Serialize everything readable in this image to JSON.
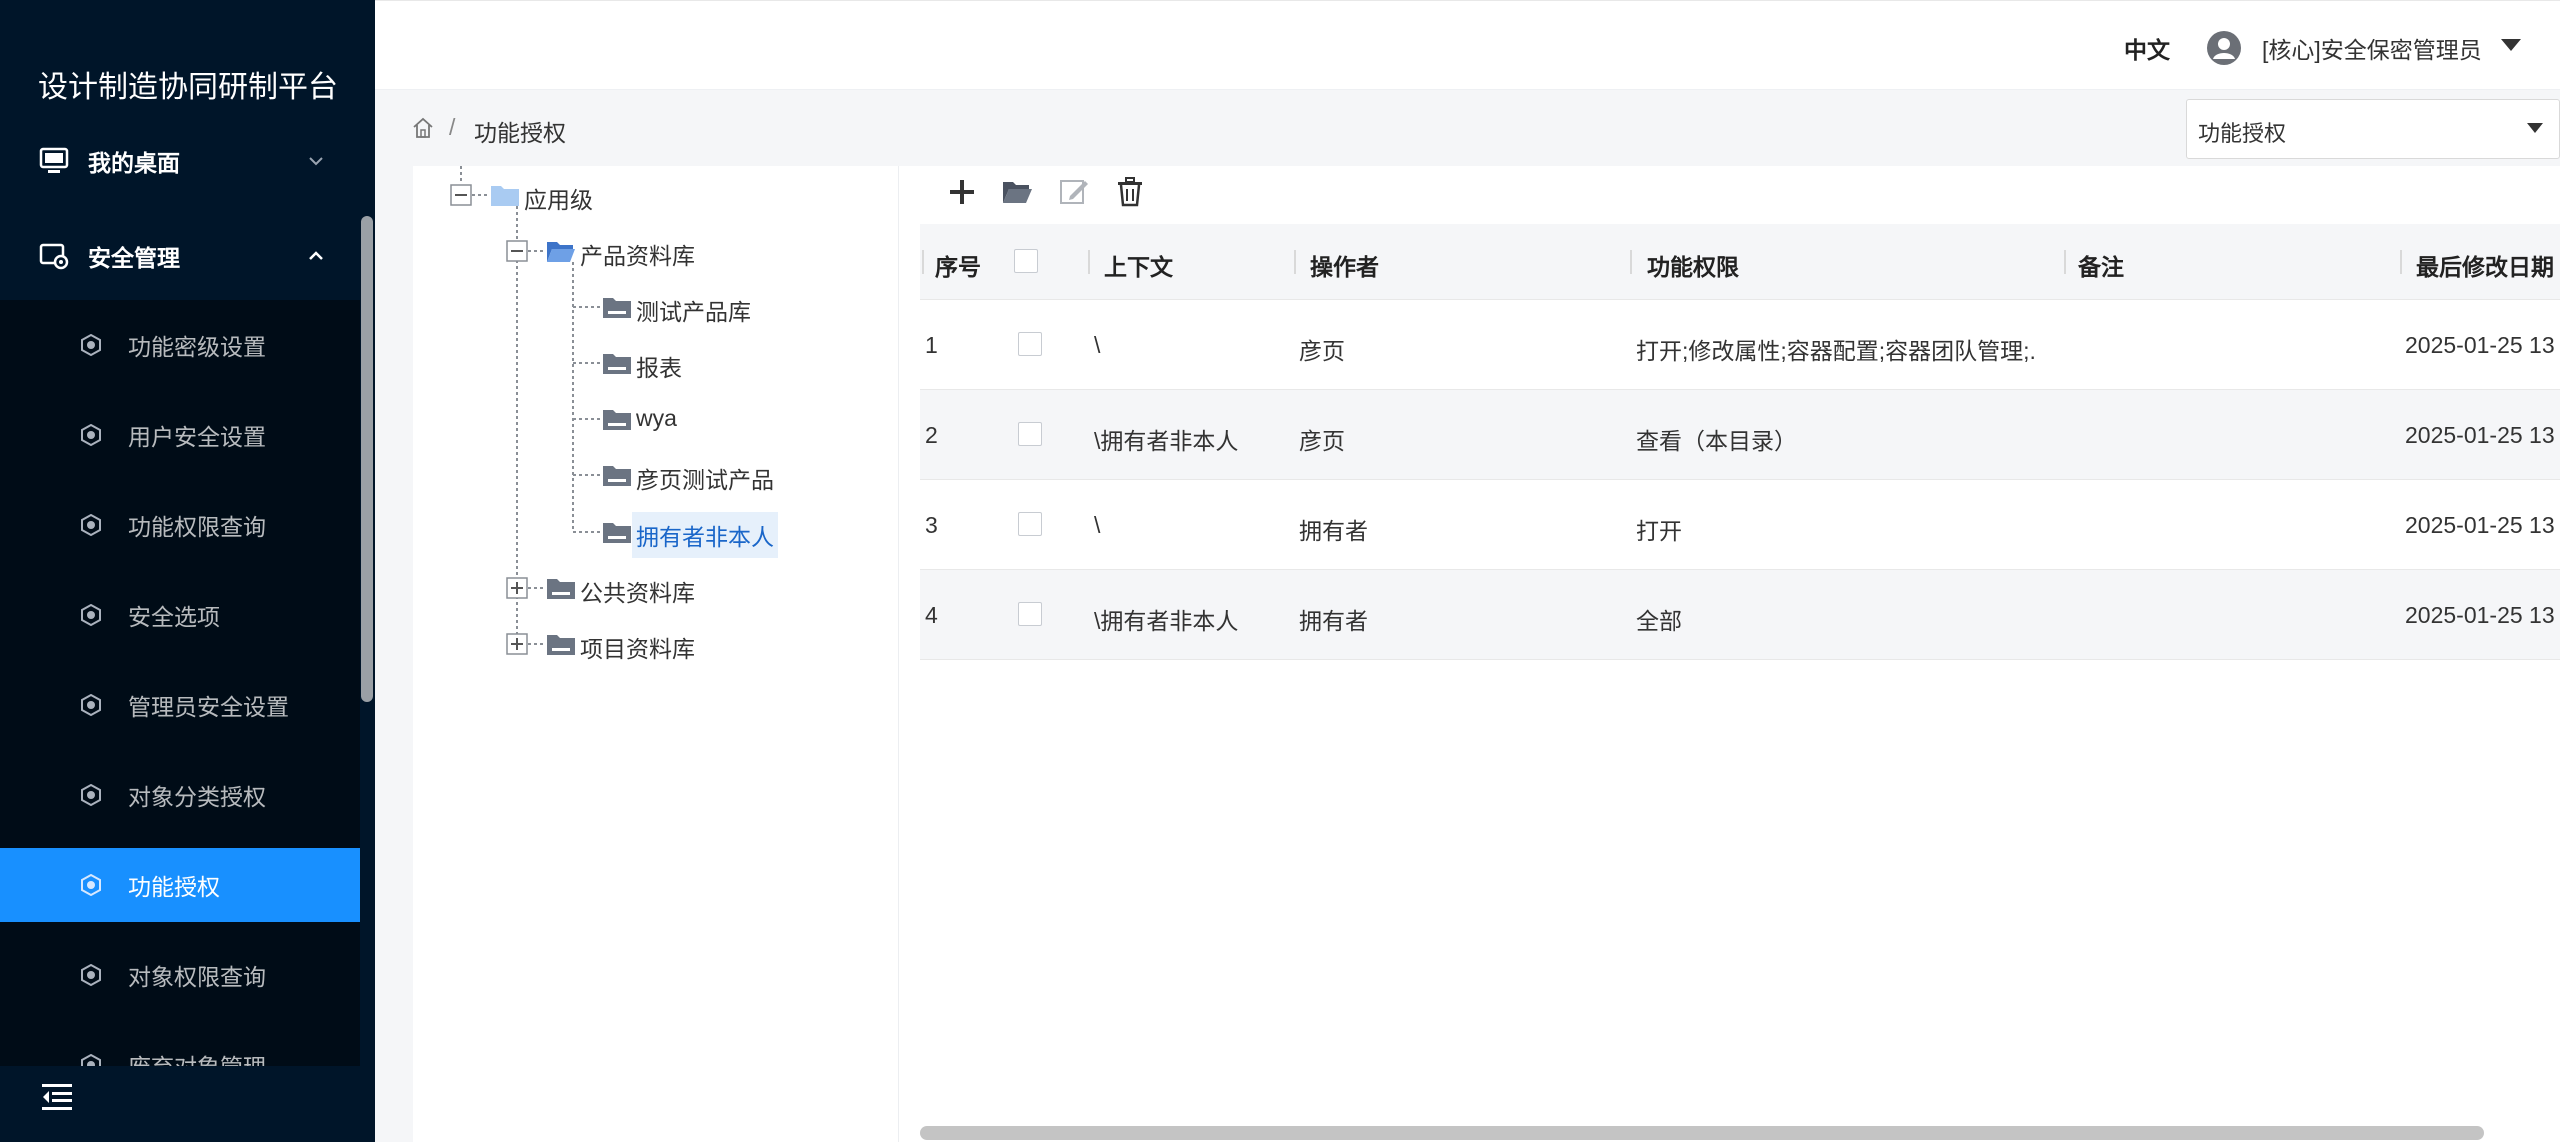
{
  "app": {
    "title": "设计制造协同研制平台"
  },
  "sidebar": {
    "groups": [
      {
        "label": "我的桌面",
        "icon": "monitor-icon",
        "expanded": false
      },
      {
        "label": "安全管理",
        "icon": "security-settings-icon",
        "expanded": true
      }
    ],
    "items": [
      {
        "label": "功能密级设置",
        "active": false
      },
      {
        "label": "用户安全设置",
        "active": false
      },
      {
        "label": "功能权限查询",
        "active": false
      },
      {
        "label": "安全选项",
        "active": false
      },
      {
        "label": "管理员安全设置",
        "active": false
      },
      {
        "label": "对象分类授权",
        "active": false
      },
      {
        "label": "功能授权",
        "active": true
      },
      {
        "label": "对象权限查询",
        "active": false
      },
      {
        "label": "废弃对象管理",
        "active": false
      }
    ]
  },
  "header": {
    "language": "中文",
    "user": "[核心]安全保密管理员"
  },
  "breadcrumb": {
    "separator": "/",
    "current": "功能授权"
  },
  "view_select": {
    "value": "功能授权"
  },
  "tree": {
    "root": "应用级",
    "product_lib": "产品资料库",
    "product_children": [
      "测试产品库",
      "报表",
      "wya",
      "彦页测试产品",
      "拥有者非本人"
    ],
    "public_lib": "公共资料库",
    "project_lib": "项目资料库",
    "selected": "拥有者非本人"
  },
  "toolbar": {
    "add": "plus-icon",
    "open": "folder-open-icon",
    "edit": "edit-icon",
    "delete": "trash-icon"
  },
  "table": {
    "columns": [
      "序号",
      "上下文",
      "操作者",
      "功能权限",
      "备注",
      "最后修改日期"
    ],
    "rows": [
      {
        "index": "1",
        "context": "\\",
        "operator": "彦页",
        "permission": "打开;修改属性;容器配置;容器团队管理;...",
        "note": "",
        "modified": "2025-01-25 13"
      },
      {
        "index": "2",
        "context": "\\拥有者非本人",
        "operator": "彦页",
        "permission": "查看（本目录）",
        "note": "",
        "modified": "2025-01-25 13"
      },
      {
        "index": "3",
        "context": "\\",
        "operator": "拥有者",
        "permission": "打开",
        "note": "",
        "modified": "2025-01-25 13"
      },
      {
        "index": "4",
        "context": "\\拥有者非本人",
        "operator": "拥有者",
        "permission": "全部",
        "note": "",
        "modified": "2025-01-25 13"
      }
    ]
  },
  "colors": {
    "sidebar_bg": "#001529",
    "submenu_bg": "#000c17",
    "active": "#1890ff"
  }
}
